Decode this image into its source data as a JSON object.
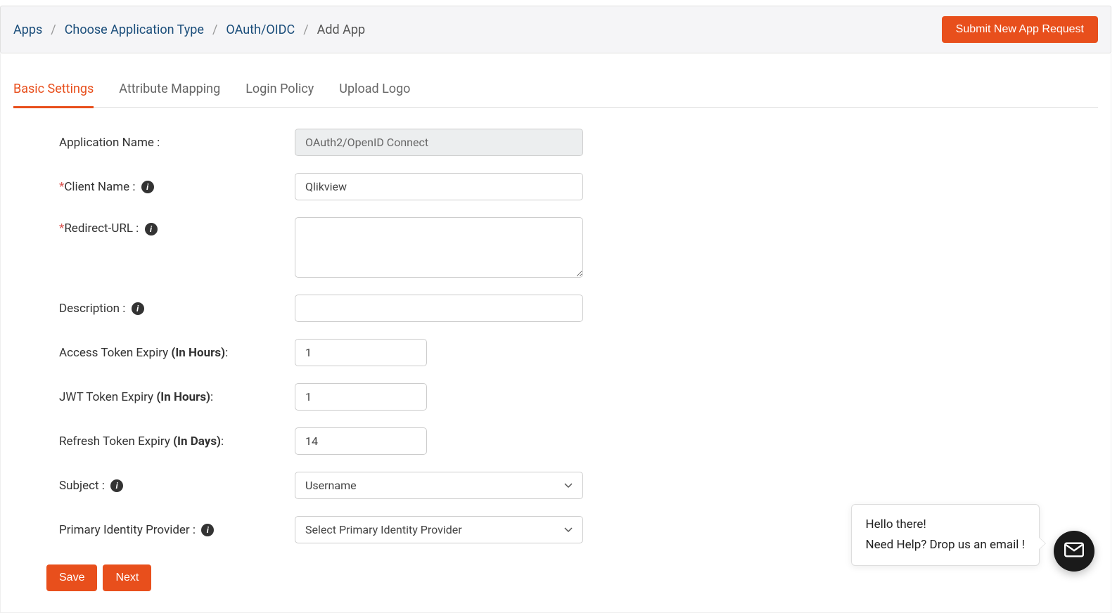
{
  "breadcrumb": {
    "apps": "Apps",
    "choose_app_type": "Choose Application Type",
    "oauth_oidc": "OAuth/OIDC",
    "current": "Add App"
  },
  "header": {
    "submit_request": "Submit New App Request"
  },
  "tabs": {
    "basic_settings": "Basic Settings",
    "attribute_mapping": "Attribute Mapping",
    "login_policy": "Login Policy",
    "upload_logo": "Upload Logo"
  },
  "form": {
    "app_name_label": "Application Name :",
    "app_name_value": "OAuth2/OpenID Connect",
    "client_name_label": "Client Name :",
    "client_name_value": "Qlikview",
    "redirect_url_label": "Redirect-URL :",
    "redirect_url_value": "",
    "description_label": "Description :",
    "description_value": "",
    "access_token_label_a": "Access Token Expiry ",
    "access_token_label_b": "(In Hours)",
    "access_token_label_c": ":",
    "access_token_value": "1",
    "jwt_token_label_a": "JWT Token Expiry ",
    "jwt_token_label_b": "(In Hours)",
    "jwt_token_label_c": ":",
    "jwt_token_value": "1",
    "refresh_token_label_a": "Refresh Token Expiry ",
    "refresh_token_label_b": "(In Days)",
    "refresh_token_label_c": ":",
    "refresh_token_value": "14",
    "subject_label": "Subject :",
    "subject_value": "Username",
    "primary_idp_label": "Primary Identity Provider :",
    "primary_idp_value": "Select Primary Identity Provider"
  },
  "buttons": {
    "save": "Save",
    "next": "Next"
  },
  "chat": {
    "greeting": "Hello there!",
    "help_text": "Need Help? Drop us an email !"
  }
}
